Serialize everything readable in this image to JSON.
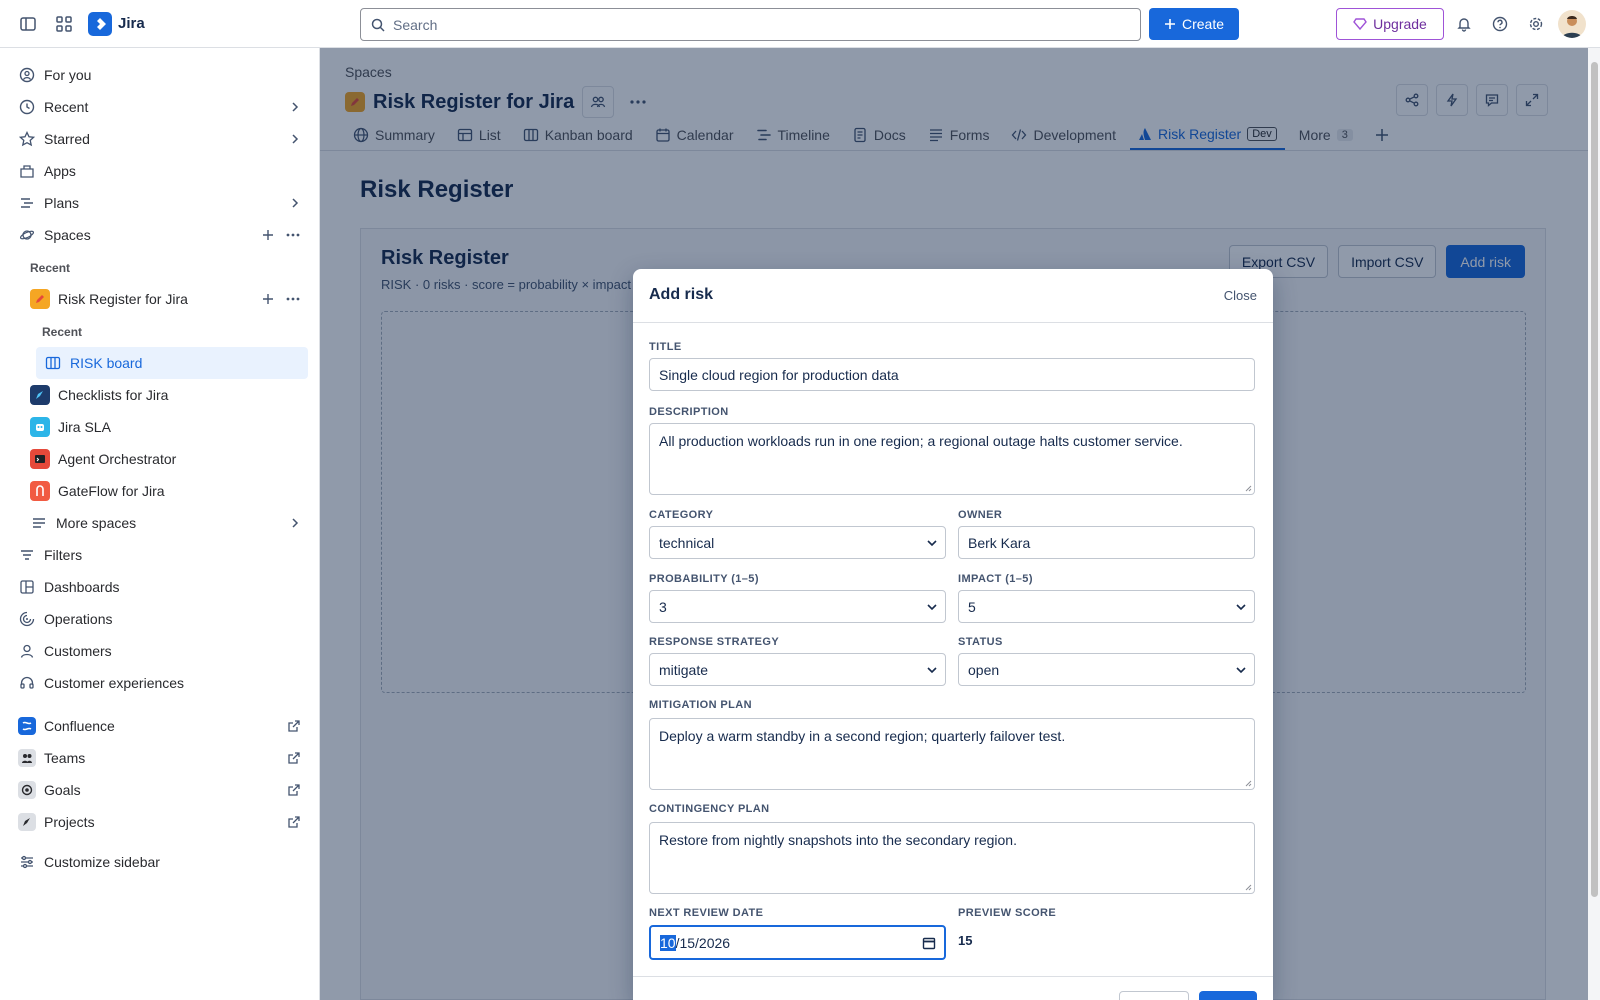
{
  "topbar": {
    "app_name": "Jira",
    "search_placeholder": "Search",
    "create_label": "Create",
    "upgrade_label": "Upgrade"
  },
  "sidebar": {
    "for_you": "For you",
    "recent": "Recent",
    "starred": "Starred",
    "apps": "Apps",
    "plans": "Plans",
    "spaces": "Spaces",
    "recent_header": "Recent",
    "space_risk": "Risk Register for Jira",
    "sub_recent_header": "Recent",
    "risk_board": "RISK board",
    "checklists": "Checklists for Jira",
    "jira_sla": "Jira SLA",
    "agent_orchestrator": "Agent Orchestrator",
    "gateflow": "GateFlow for Jira",
    "more_spaces": "More spaces",
    "filters": "Filters",
    "dashboards": "Dashboards",
    "operations": "Operations",
    "customers": "Customers",
    "customer_experiences": "Customer experiences",
    "confluence": "Confluence",
    "teams": "Teams",
    "goals": "Goals",
    "projects": "Projects",
    "customize": "Customize sidebar"
  },
  "header": {
    "breadcrumb": "Spaces",
    "title": "Risk Register for Jira"
  },
  "tabs": {
    "summary": "Summary",
    "list": "List",
    "kanban": "Kanban board",
    "calendar": "Calendar",
    "timeline": "Timeline",
    "docs": "Docs",
    "forms": "Forms",
    "development": "Development",
    "risk_register": "Risk Register",
    "dev_badge": "Dev",
    "more": "More",
    "more_count": "3"
  },
  "page": {
    "heading": "Risk Register",
    "app_heading": "Risk Register",
    "app_subtitle": "RISK · 0 risks · score = probability × impact",
    "export_csv": "Export CSV",
    "import_csv": "Import CSV",
    "add_risk": "Add risk"
  },
  "modal": {
    "title": "Add risk",
    "close": "Close",
    "title_label": "TITLE",
    "title_value": "Single cloud region for production data",
    "description_label": "DESCRIPTION",
    "description_value": "All production workloads run in one region; a regional outage halts customer service.",
    "category_label": "CATEGORY",
    "category_value": "technical",
    "owner_label": "OWNER",
    "owner_value": "Berk Kara",
    "probability_label": "PROBABILITY (1–5)",
    "probability_value": "3",
    "impact_label": "IMPACT (1–5)",
    "impact_value": "5",
    "response_label": "RESPONSE STRATEGY",
    "response_value": "mitigate",
    "status_label": "STATUS",
    "status_value": "open",
    "mitigation_label": "MITIGATION PLAN",
    "mitigation_value": "Deploy a warm standby in a second region; quarterly failover test.",
    "contingency_label": "CONTINGENCY PLAN",
    "contingency_value": "Restore from nightly snapshots into the secondary region.",
    "review_label": "NEXT REVIEW DATE",
    "review_month": "10",
    "review_rest": "/15/2026",
    "preview_label": "PREVIEW SCORE",
    "preview_value": "15"
  },
  "colors": {
    "brand": "#1868db",
    "upgrade": "#9f53d7",
    "overlay": "rgba(9,30,66,0.45)"
  }
}
